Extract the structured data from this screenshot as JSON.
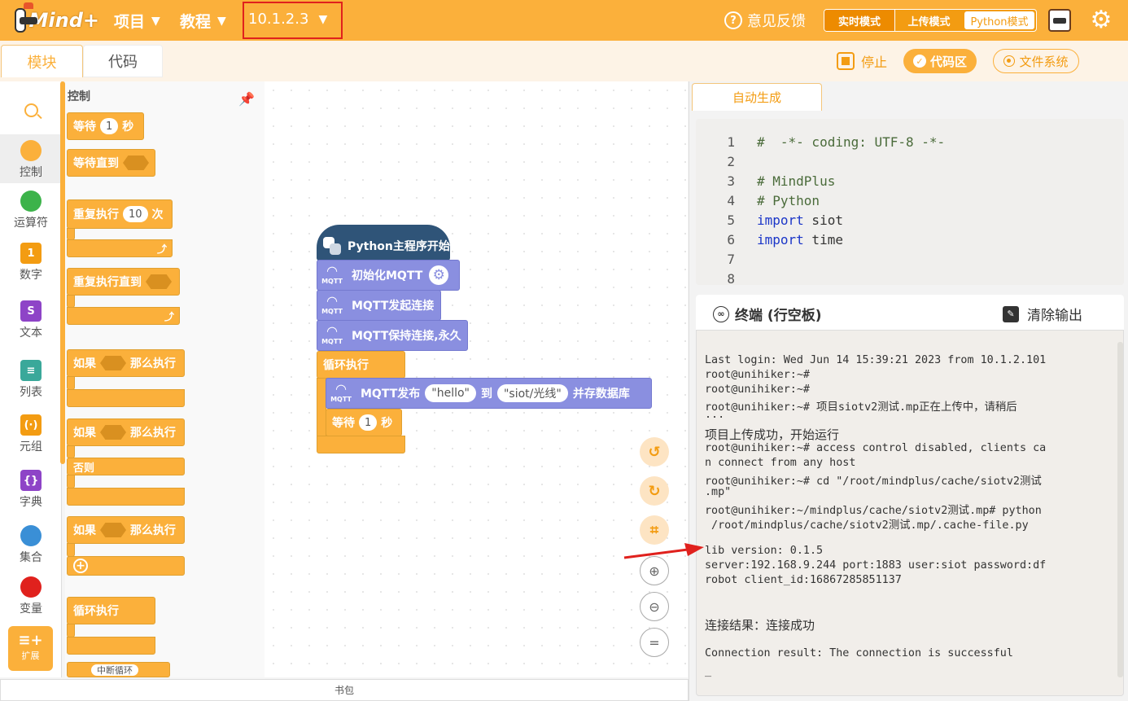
{
  "topbar": {
    "logo_text": "Mind+",
    "menu_project": "项目",
    "menu_tutorial": "教程",
    "version": "10.1.2.3",
    "feedback": "意见反馈",
    "mode_realtime": "实时模式",
    "mode_upload": "上传模式",
    "mode_python": "Python模式"
  },
  "subbar": {
    "tab_module": "模块",
    "tab_code": "代码",
    "stop": "停止",
    "code_area": "代码区",
    "file_system": "文件系统"
  },
  "categories": [
    {
      "label": "控制",
      "color": "#fbb03b"
    },
    {
      "label": "运算符",
      "color": "#3cb34a"
    },
    {
      "label": "数字",
      "color": "#f39c12",
      "icon": "1"
    },
    {
      "label": "文本",
      "color": "#8e44c7",
      "icon": "S"
    },
    {
      "label": "列表",
      "color": "#3aa89a",
      "icon": "≡"
    },
    {
      "label": "元组",
      "color": "#f39c12",
      "icon": "(·)"
    },
    {
      "label": "字典",
      "color": "#8e44c7",
      "icon": "{}"
    },
    {
      "label": "集合",
      "color": "#3a8fd6"
    },
    {
      "label": "变量",
      "color": "#e0211d"
    }
  ],
  "extension": "扩展",
  "flyout": {
    "title": "控制",
    "wait": "等待",
    "wait_value": "1",
    "seconds": "秒",
    "wait_until": "等待直到",
    "repeat": "重复执行",
    "repeat_value": "10",
    "times": "次",
    "repeat_until": "重复执行直到",
    "if": "如果",
    "then": "那么执行",
    "else": "否则",
    "loop": "循环执行",
    "break_loop": "中断循环"
  },
  "workspace": {
    "hat": "Python主程序开始",
    "mqtt_label": "MQTT",
    "init_mqtt": "初始化MQTT",
    "connect": "MQTT发起连接",
    "keep_alive": "MQTT保持连接,永久",
    "loop": "循环执行",
    "publish": "MQTT发布",
    "publish_msg": "\"hello\"",
    "to": "到",
    "topic": "\"siot/光线\"",
    "save_db": "并存数据库",
    "wait": "等待",
    "wait_value": "1",
    "seconds": "秒"
  },
  "backpack": "书包",
  "code_panel": {
    "tab": "自动生成",
    "lines": [
      {
        "n": "1",
        "text": "#  -*- coding: UTF-8 -*-"
      },
      {
        "n": "2",
        "text": ""
      },
      {
        "n": "3",
        "text": "# MindPlus"
      },
      {
        "n": "4",
        "text": "# Python"
      },
      {
        "n": "5",
        "kw": "import",
        "rest": " siot"
      },
      {
        "n": "6",
        "kw": "import",
        "rest": " time"
      },
      {
        "n": "7",
        "text": ""
      },
      {
        "n": "8",
        "text": ""
      }
    ]
  },
  "terminal": {
    "title": "终端 (行空板)",
    "clear": "清除输出",
    "lines": [
      "Last login: Wed Jun 14 15:39:21 2023 from 10.1.2.101",
      "root@unihiker:~#",
      "root@unihiker:~#",
      "root@unihiker:~# 项目siotv2测试.mp正在上传中，请稍后",
      "...",
      "项目上传成功，开始运行",
      "root@unihiker:~# access control disabled, clients ca",
      "n connect from any host",
      "root@unihiker:~# cd \"/root/mindplus/cache/siotv2测试",
      ".mp\"",
      "root@unihiker:~/mindplus/cache/siotv2测试.mp# python",
      " /root/mindplus/cache/siotv2测试.mp/.cache-file.py",
      "",
      "lib version: 0.1.5",
      "server:192.168.9.244 port:1883 user:siot password:df",
      "robot client_id:16867285851137",
      "",
      "",
      "连接结果：连接成功",
      "",
      "Connection result: The connection is successful",
      "_"
    ]
  }
}
